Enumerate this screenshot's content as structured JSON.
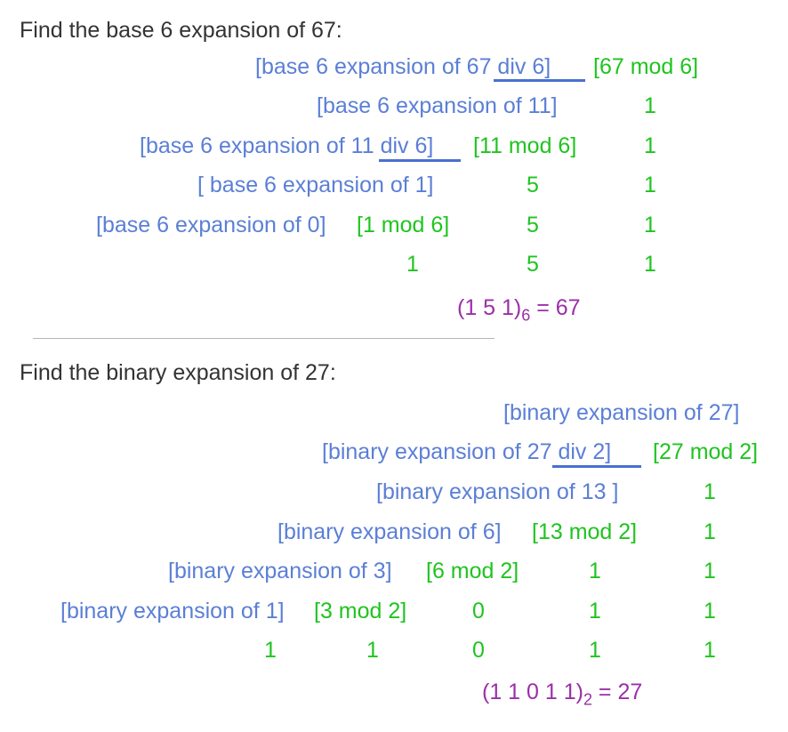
{
  "problem1": {
    "heading": "Find the base 6 expansion of 67:",
    "row1": {
      "left": "[base 6 expansion of ",
      "underlined": "67 div 6",
      "right": "]",
      "mod": "[67 mod 6]"
    },
    "row2": {
      "expr": "[base 6 expansion of 11]",
      "d0": "1"
    },
    "row3": {
      "left": "[base 6 expansion of ",
      "underlined": "11 div 6",
      "right": "]",
      "mod": "[11 mod 6]",
      "d0": "1"
    },
    "row4": {
      "expr": "[ base 6 expansion of 1]",
      "d1": "5",
      "d0": "1"
    },
    "row5": {
      "expr": "[base 6 expansion of 0]",
      "mod": "[1 mod 6]",
      "d1": "5",
      "d0": "1"
    },
    "row6": {
      "d2": "1",
      "d1": "5",
      "d0": "1"
    },
    "result": {
      "digits": "(1 5 1)",
      "base": "6",
      "equals": " = 67"
    }
  },
  "problem2": {
    "heading": "Find the binary expansion of 27:",
    "row1": {
      "expr": "[binary expansion of 27]"
    },
    "row2": {
      "left": "[binary expansion of ",
      "underlined": "27 div 2",
      "right": "]",
      "mod": "[27 mod 2]"
    },
    "row3": {
      "expr": "[binary expansion of 13 ]",
      "d0": "1"
    },
    "row4": {
      "expr": "[binary expansion of 6]",
      "mod": "[13 mod 2]",
      "d0": "1"
    },
    "row5": {
      "expr": "[binary expansion of 3]",
      "mod": "[6 mod 2]",
      "d1": "1",
      "d0": "1"
    },
    "row6": {
      "expr": "[binary expansion of 1]",
      "mod": "[3 mod 2]",
      "d2": "0",
      "d1": "1",
      "d0": "1"
    },
    "row7": {
      "d4": "1",
      "d3": "1",
      "d2": "0",
      "d1": "1",
      "d0": "1"
    },
    "result": {
      "digits": "(1 1 0 1 1)",
      "base": "2",
      "equals": " = 27"
    }
  }
}
